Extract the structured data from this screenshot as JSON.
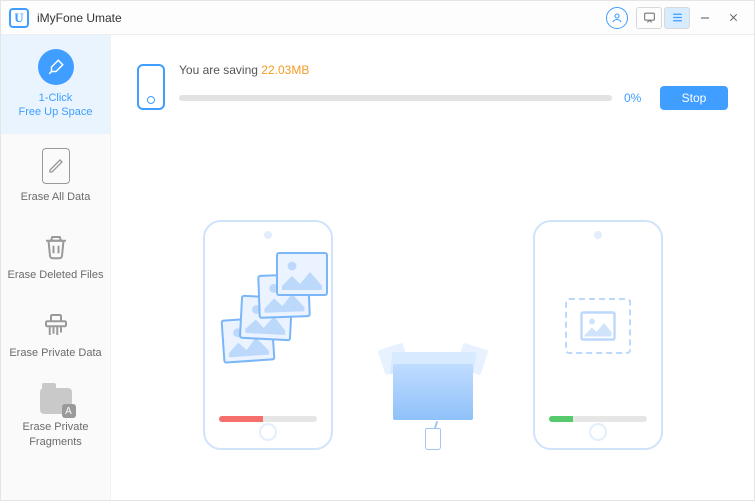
{
  "titlebar": {
    "logo_letter": "U",
    "title": "iMyFone Umate"
  },
  "sidebar": {
    "items": [
      {
        "label": "1-Click\nFree Up Space"
      },
      {
        "label": "Erase All Data"
      },
      {
        "label": "Erase Deleted Files"
      },
      {
        "label": "Erase Private Data"
      },
      {
        "label": "Erase Private\nFragments"
      }
    ]
  },
  "progress": {
    "prefix": "You are saving ",
    "amount": "22.03MB",
    "percent": "0%",
    "stop_label": "Stop"
  }
}
